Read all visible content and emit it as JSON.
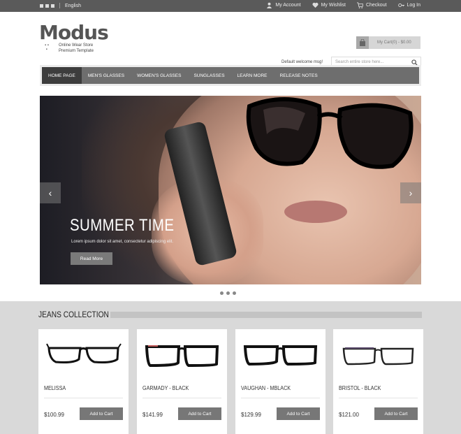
{
  "topbar": {
    "language": "English",
    "links": [
      {
        "label": "My Account",
        "icon": "user-icon"
      },
      {
        "label": "My Wishlist",
        "icon": "heart-icon"
      },
      {
        "label": "Checkout",
        "icon": "cart-icon"
      },
      {
        "label": "Log In",
        "icon": "key-icon"
      }
    ]
  },
  "header": {
    "logo": "Modus",
    "tagline_1": "Online Wear Store",
    "tagline_2": "Premium Template",
    "cart_label": "My Cart(0) - $0.00",
    "welcome": "Default welcome msg!",
    "search_placeholder": "Search entire store here..."
  },
  "nav": {
    "items": [
      "HOME PAGE",
      "MEN'S GLASSES",
      "WOMEN'S GLASSES",
      "SUNGLASSES",
      "LEARN MORE",
      "RELEASE NOTES"
    ]
  },
  "slider": {
    "title": "SUMMER TIME",
    "text": "Lorem ipsum dolor sit amet, consectetur adipiscing elit.",
    "button": "Read More",
    "prev": "‹",
    "next": "›"
  },
  "collection": {
    "title": "JEANS COLLECTION",
    "products": [
      {
        "name": "MELISSA",
        "price": "$100.99",
        "button": "Add to Cart"
      },
      {
        "name": "GARMADY - BLACK",
        "price": "$141.99",
        "button": "Add to Cart"
      },
      {
        "name": "VAUGHAN - MBLACK",
        "price": "$129.99",
        "button": "Add to Cart"
      },
      {
        "name": "BRISTOL - BLACK",
        "price": "$121.00",
        "button": "Add to Cart"
      }
    ]
  }
}
